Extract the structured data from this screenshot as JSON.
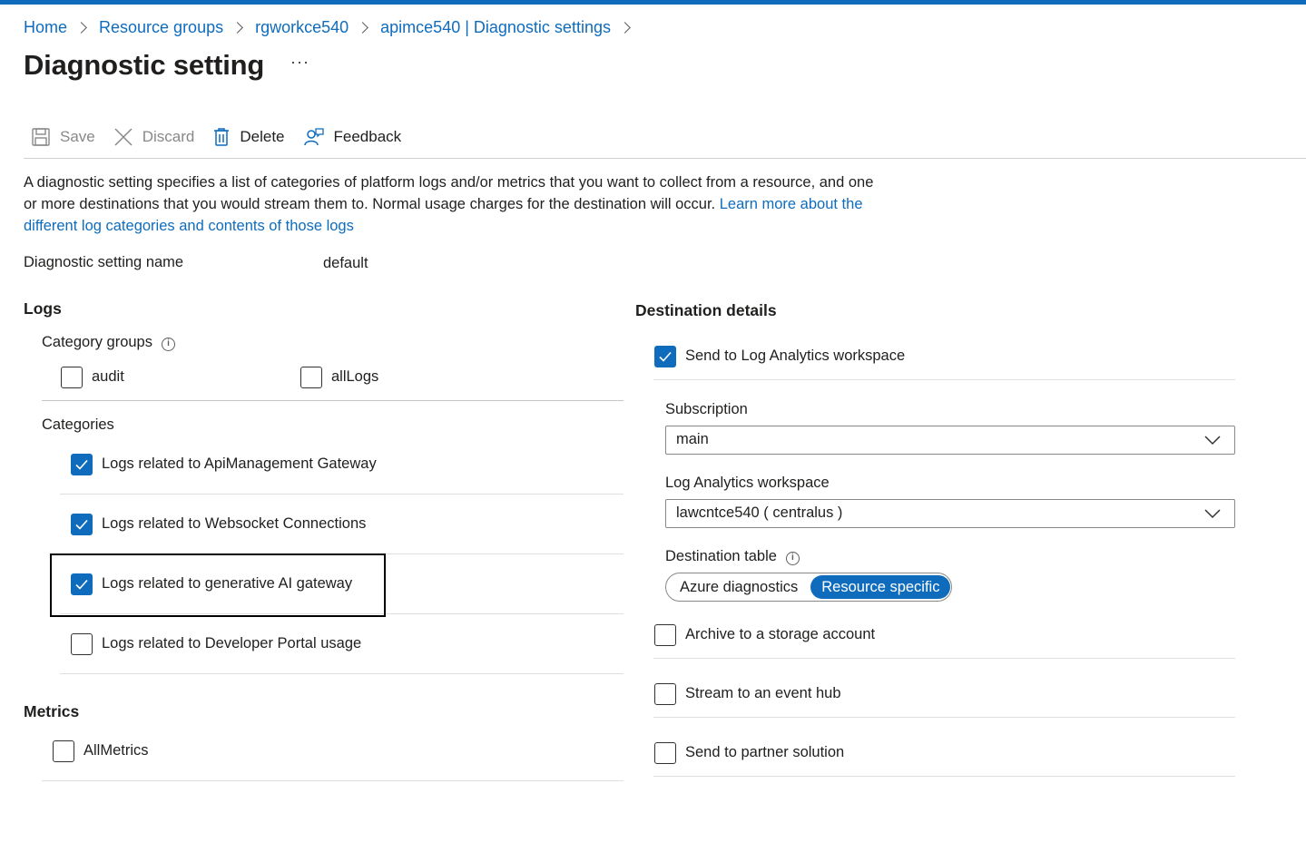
{
  "breadcrumb": [
    {
      "label": "Home"
    },
    {
      "label": "Resource groups"
    },
    {
      "label": "rgworkce540"
    },
    {
      "label": "apimce540 | Diagnostic settings"
    }
  ],
  "page": {
    "title": "Diagnostic setting",
    "more": "···"
  },
  "toolbar": {
    "save": "Save",
    "discard": "Discard",
    "delete": "Delete",
    "feedback": "Feedback"
  },
  "description": {
    "text": "A diagnostic setting specifies a list of categories of platform logs and/or metrics that you want to collect from a resource, and one or more destinations that you would stream them to. Normal usage charges for the destination will occur. ",
    "link": "Learn more about the different log categories and contents of those logs"
  },
  "setting_name": {
    "label": "Diagnostic setting name",
    "value": "default"
  },
  "logs": {
    "title": "Logs",
    "category_groups_label": "Category groups",
    "category_groups": [
      {
        "label": "audit",
        "checked": false
      },
      {
        "label": "allLogs",
        "checked": false
      }
    ],
    "categories_label": "Categories",
    "categories": [
      {
        "label": "Logs related to ApiManagement Gateway",
        "checked": true
      },
      {
        "label": "Logs related to Websocket Connections",
        "checked": true
      },
      {
        "label": "Logs related to generative AI gateway",
        "checked": true
      },
      {
        "label": "Logs related to Developer Portal usage",
        "checked": false
      }
    ]
  },
  "metrics": {
    "title": "Metrics",
    "items": [
      {
        "label": "AllMetrics",
        "checked": false
      }
    ]
  },
  "destination": {
    "title": "Destination details",
    "log_analytics": {
      "label": "Send to Log Analytics workspace",
      "checked": true
    },
    "subscription_label": "Subscription",
    "subscription_value": "main",
    "workspace_label": "Log Analytics workspace",
    "workspace_value": "lawcntce540 ( centralus )",
    "table_label": "Destination table",
    "table_options": [
      "Azure diagnostics",
      "Resource specific"
    ],
    "table_selected": "Resource specific",
    "archive": {
      "label": "Archive to a storage account",
      "checked": false
    },
    "event_hub": {
      "label": "Stream to an event hub",
      "checked": false
    },
    "partner": {
      "label": "Send to partner solution",
      "checked": false
    }
  },
  "colors": {
    "accent": "#0f6cbd",
    "text": "#201f1e",
    "disabled": "#8a8886"
  },
  "icons": [
    "save-icon",
    "discard-icon",
    "delete-icon",
    "feedback-icon",
    "info-icon",
    "chevron-down-icon",
    "checkmark-icon"
  ]
}
